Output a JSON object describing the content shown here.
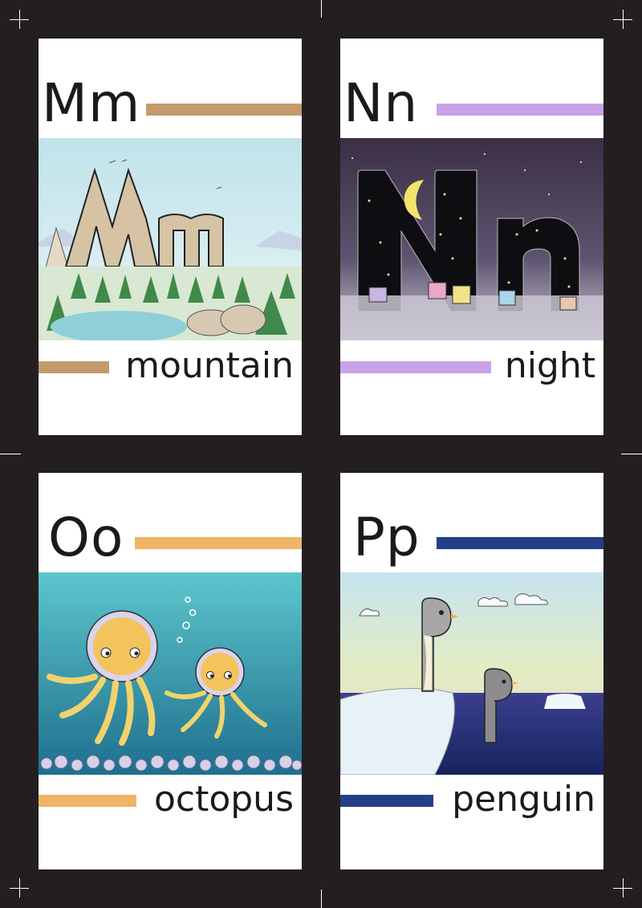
{
  "cards": [
    {
      "letters": "Mm",
      "word": "mountain",
      "color": "#c49a6c",
      "picture": "mountain-scene"
    },
    {
      "letters": "Nn",
      "word": "night",
      "color": "#c8a2e8",
      "picture": "night-scene"
    },
    {
      "letters": "Oo",
      "word": "octopus",
      "color": "#f0b466",
      "picture": "octopus-scene"
    },
    {
      "letters": "Pp",
      "word": "penguin",
      "color": "#233f86",
      "picture": "penguin-scene"
    }
  ]
}
